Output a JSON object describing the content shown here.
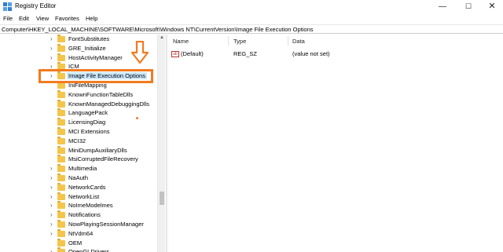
{
  "window": {
    "title": "Registry Editor",
    "minimize_glyph": "—",
    "maximize_glyph": "☐",
    "close_glyph": "✕"
  },
  "menu": [
    "File",
    "Edit",
    "View",
    "Favorites",
    "Help"
  ],
  "address": "Computer\\HKEY_LOCAL_MACHINE\\SOFTWARE\\Microsoft\\Windows NT\\CurrentVersion\\Image File Execution Options",
  "tree": {
    "items": [
      {
        "label": "FontSubstitutes",
        "expandable": true
      },
      {
        "label": "GRE_Initialize",
        "expandable": true
      },
      {
        "label": "HostActivityManager",
        "expandable": true
      },
      {
        "label": "ICM",
        "expandable": true
      },
      {
        "label": "Image File Execution Options",
        "expandable": true,
        "selected": true
      },
      {
        "label": "IniFileMapping",
        "expandable": false
      },
      {
        "label": "KnownFunctionTableDlls",
        "expandable": false
      },
      {
        "label": "KnownManagedDebuggingDlls",
        "expandable": false
      },
      {
        "label": "LanguagePack",
        "expandable": false
      },
      {
        "label": "LicensingDiag",
        "expandable": false
      },
      {
        "label": "MCI Extensions",
        "expandable": false
      },
      {
        "label": "MCI32",
        "expandable": false
      },
      {
        "label": "MiniDumpAuxiliaryDlls",
        "expandable": false
      },
      {
        "label": "MsiCorruptedFileRecovery",
        "expandable": false
      },
      {
        "label": "Multimedia",
        "expandable": true
      },
      {
        "label": "NaAuth",
        "expandable": true
      },
      {
        "label": "NetworkCards",
        "expandable": true
      },
      {
        "label": "NetworkList",
        "expandable": true
      },
      {
        "label": "NoImeModelmes",
        "expandable": true
      },
      {
        "label": "Notifications",
        "expandable": true
      },
      {
        "label": "NowPlayingSessionManager",
        "expandable": true
      },
      {
        "label": "NtVdm64",
        "expandable": true
      },
      {
        "label": "OEM",
        "expandable": false
      },
      {
        "label": "OpenGLDrivers",
        "expandable": true
      }
    ]
  },
  "list": {
    "columns": {
      "name": "Name",
      "type": "Type",
      "data": "Data"
    },
    "rows": [
      {
        "icon": "string-value-icon",
        "icon_text": "ab",
        "name": "(Default)",
        "type": "REG_SZ",
        "data": "(value not set)"
      }
    ]
  },
  "annotation": {
    "color": "#f17b20",
    "arrow": "down-arrow-icon"
  },
  "colors": {
    "selection": "#cce8ff",
    "folder": "#f3c54c"
  }
}
